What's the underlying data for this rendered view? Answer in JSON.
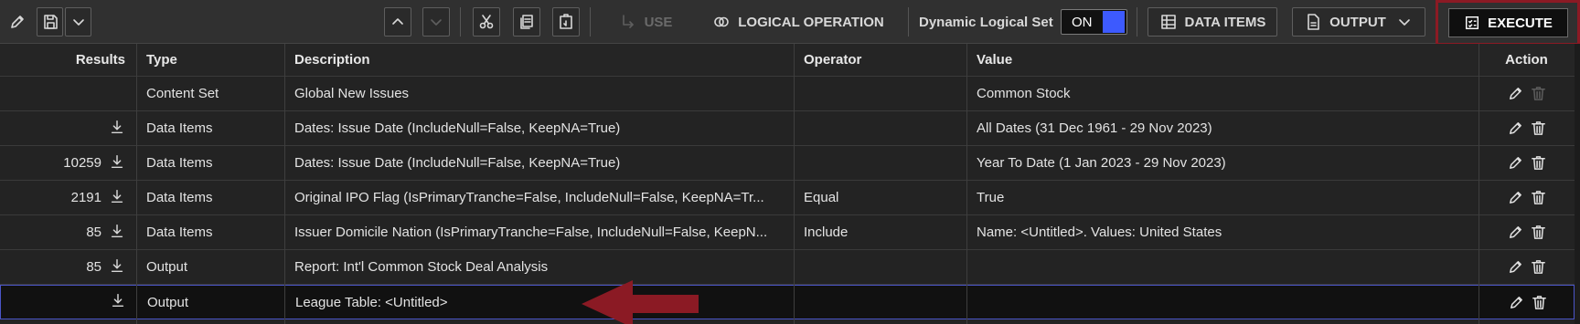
{
  "toolbar": {
    "use_label": "USE",
    "logical_operation_label": "LOGICAL OPERATION",
    "dynamic_set_label": "Dynamic Logical Set",
    "toggle_state": "ON",
    "data_items_label": "DATA ITEMS",
    "output_label": "OUTPUT",
    "execute_label": "EXECUTE",
    "accent_color": "#3d5afe",
    "highlight_color": "#8b1a24",
    "icons": [
      "pencil-icon",
      "save-icon",
      "chevron-down-icon",
      "chevron-up-icon",
      "chevron-down-icon",
      "scissors-icon",
      "copy-icon",
      "paste-icon",
      "use-arrow-icon",
      "logical-operation-icon",
      "grid-icon",
      "output-doc-icon",
      "execute-checklist-icon"
    ]
  },
  "table": {
    "columns": {
      "results": "Results",
      "type": "Type",
      "description": "Description",
      "operator": "Operator",
      "value": "Value",
      "action": "Action"
    },
    "rows": [
      {
        "results": "",
        "download": false,
        "type": "Content Set",
        "description": "Global New Issues",
        "operator": "",
        "value": "Common Stock",
        "delete_enabled": false
      },
      {
        "results": "",
        "download": true,
        "type": "Data Items",
        "description": "Dates: Issue Date (IncludeNull=False, KeepNA=True)",
        "operator": "",
        "value": "All Dates (31 Dec 1961 - 29 Nov 2023)",
        "delete_enabled": true
      },
      {
        "results": "10259",
        "download": true,
        "type": "Data Items",
        "description": "Dates: Issue Date (IncludeNull=False, KeepNA=True)",
        "operator": "",
        "value": "Year To Date (1 Jan 2023 - 29 Nov 2023)",
        "delete_enabled": true
      },
      {
        "results": "2191",
        "download": true,
        "type": "Data Items",
        "description": "Original IPO Flag (IsPrimaryTranche=False, IncludeNull=False, KeepNA=Tr...",
        "operator": "Equal",
        "value": "True",
        "delete_enabled": true
      },
      {
        "results": "85",
        "download": true,
        "type": "Data Items",
        "description": "Issuer Domicile Nation (IsPrimaryTranche=False, IncludeNull=False, KeepN...",
        "operator": "Include",
        "value": "Name: <Untitled>. Values: United States",
        "delete_enabled": true
      },
      {
        "results": "85",
        "download": true,
        "type": "Output",
        "description": "Report: Int'l Common Stock Deal Analysis",
        "operator": "",
        "value": "",
        "delete_enabled": true
      },
      {
        "results": "",
        "download": true,
        "type": "Output",
        "description": "League Table: <Untitled>",
        "operator": "",
        "value": "",
        "delete_enabled": true
      }
    ]
  }
}
